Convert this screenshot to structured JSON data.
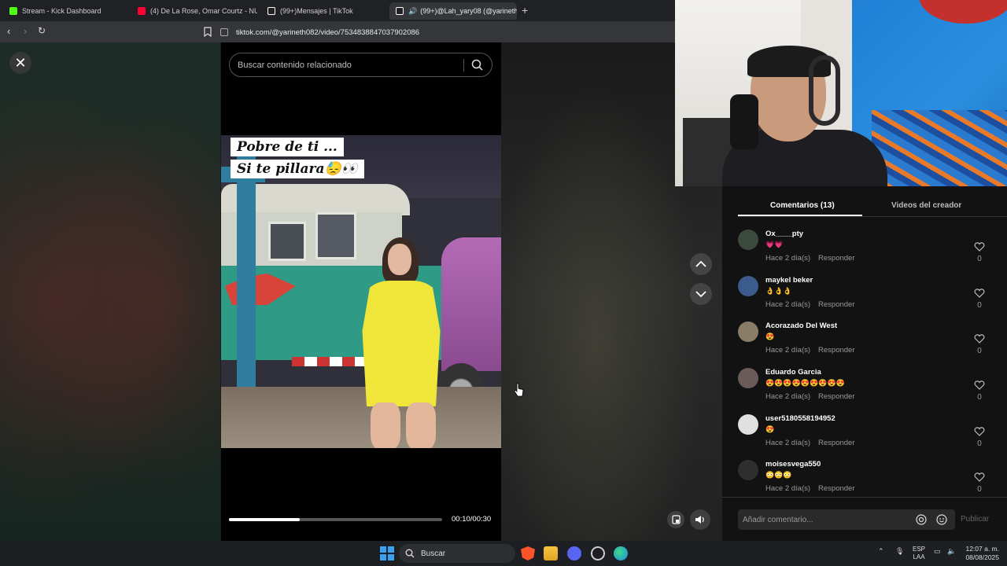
{
  "browser": {
    "tabs": [
      {
        "label": "Stream - Kick Dashboard",
        "icon": "kick-icon",
        "color": "#53fc18"
      },
      {
        "label": "(4) De La Rose, Omar Courtz - NUBE",
        "icon": "youtube-icon",
        "color": "#ff0033"
      },
      {
        "label": "(99+)Mensajes | TikTok",
        "icon": "tiktok-icon",
        "color": "#ffffff"
      },
      {
        "label": "(99+)@Lah_yary08 (@yarineth",
        "icon": "tiktok-icon",
        "color": "#ffffff"
      }
    ],
    "url": "tiktok.com/@yarineth082/video/7534838847037902086"
  },
  "search": {
    "placeholder": "Buscar contenido relacionado"
  },
  "video": {
    "caption_line1": "Pobre de ti ...",
    "caption_line2": "Si te pillara😓👀",
    "current_time": "00:10",
    "duration": "00:30",
    "time_display": "00:10/00:30",
    "progress": 0.333
  },
  "panel": {
    "tab_comments": "Comentarios (13)",
    "tab_creator": "Videos del creador",
    "comments": [
      {
        "user": "Ox____pty",
        "text": "💗💗",
        "time": "Hace 2 día(s)",
        "reply": "Responder",
        "likes": "0",
        "avatar_color": "#3b4a3e"
      },
      {
        "user": "maykel beker",
        "text": "👌👌👌",
        "time": "Hace 2 día(s)",
        "reply": "Responder",
        "likes": "0",
        "avatar_color": "#3a5b8c"
      },
      {
        "user": "Acorazado Del West",
        "text": "😍",
        "time": "Hace 2 día(s)",
        "reply": "Responder",
        "likes": "0",
        "avatar_color": "#8a7d68"
      },
      {
        "user": "Eduardo Garcia",
        "text": "😍😍😍😍😍😍😍😍😍",
        "time": "Hace 2 día(s)",
        "reply": "Responder",
        "likes": "0",
        "avatar_color": "#6b5a5a"
      },
      {
        "user": "user5180558194952",
        "text": "😍",
        "time": "Hace 2 día(s)",
        "reply": "Responder",
        "likes": "0",
        "avatar_color": "#e0e0e0"
      },
      {
        "user": "moisesvega550",
        "text": "😳😳😳",
        "time": "Hace 2 día(s)",
        "reply": "Responder",
        "likes": "0",
        "avatar_color": "#2e2e2e"
      }
    ],
    "input_placeholder": "Añadir comentario...",
    "publish_label": "Publicar"
  },
  "taskbar": {
    "search_label": "Buscar",
    "lang_line1": "ESP",
    "lang_line2": "LAA",
    "time": "12:07 a. m.",
    "date": "08/08/2025"
  }
}
